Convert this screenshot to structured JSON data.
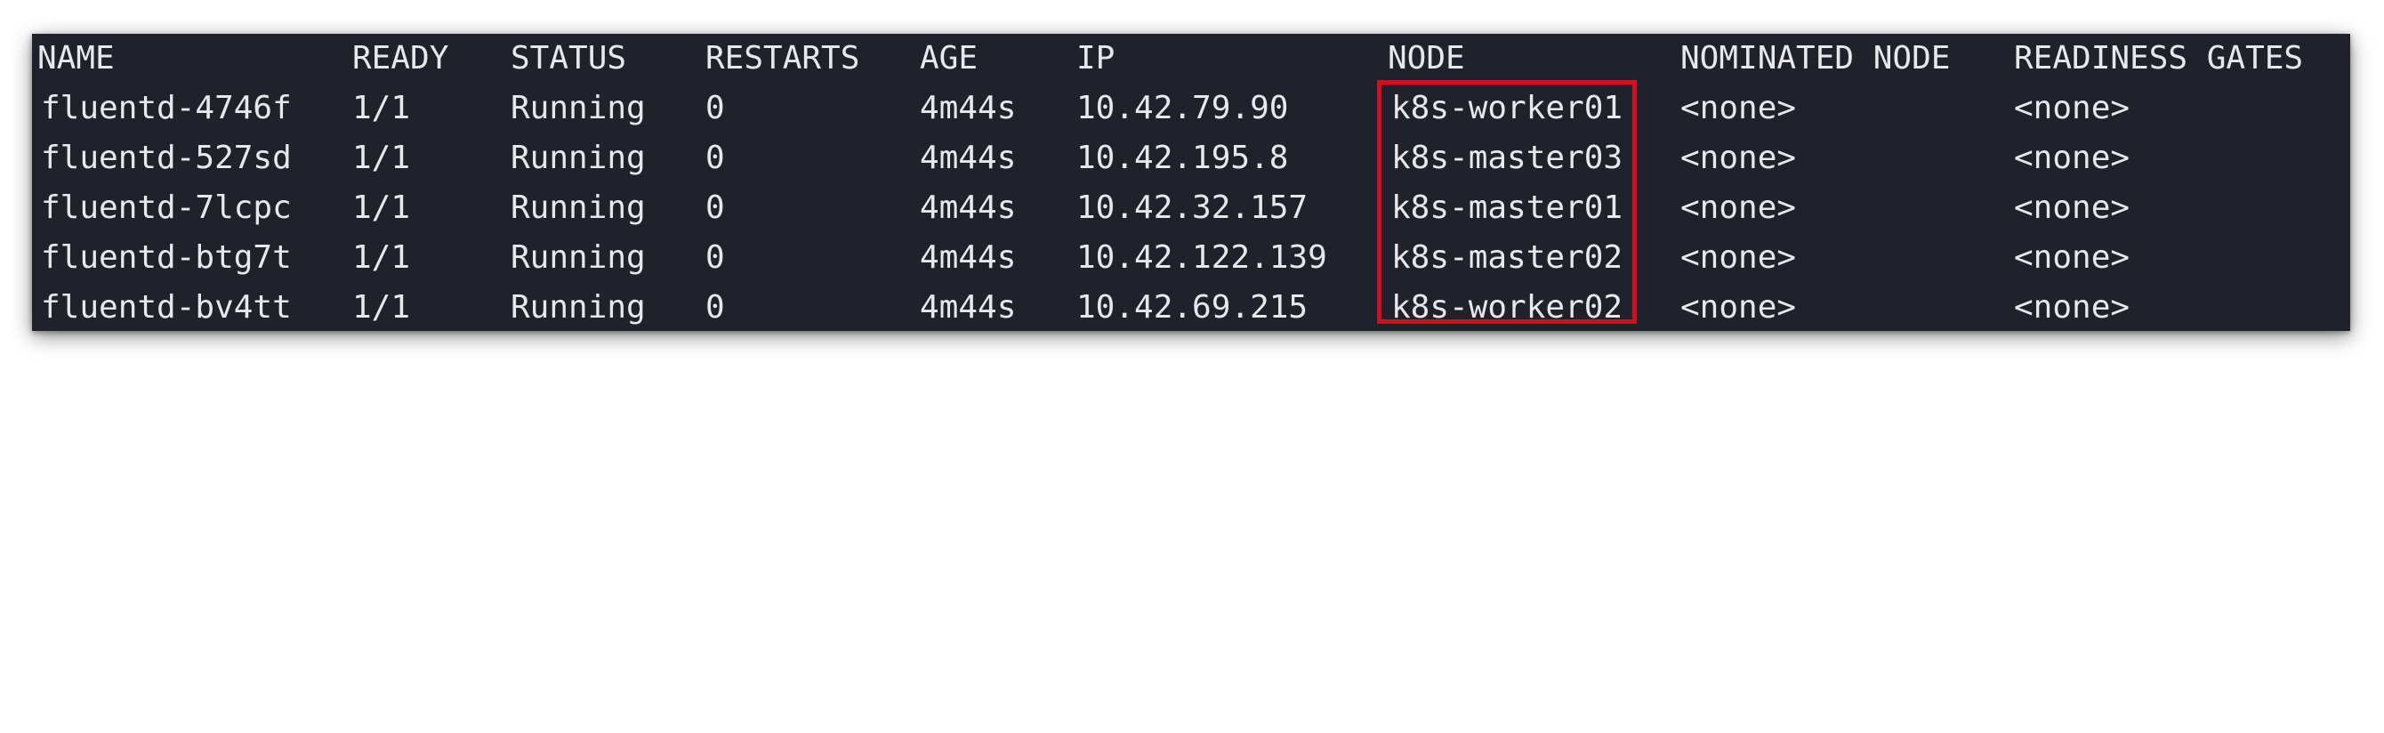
{
  "table": {
    "headers": {
      "name": "NAME",
      "ready": "READY",
      "status": "STATUS",
      "restarts": "RESTARTS",
      "age": "AGE",
      "ip": "IP",
      "node": "NODE",
      "nominated_node": "NOMINATED NODE",
      "readiness_gates": "READINESS GATES"
    },
    "rows": [
      {
        "name": "fluentd-4746f",
        "ready": "1/1",
        "status": "Running",
        "restarts": "0",
        "age": "4m44s",
        "ip": "10.42.79.90",
        "node": "k8s-worker01",
        "nominated_node": "<none>",
        "readiness_gates": "<none>"
      },
      {
        "name": "fluentd-527sd",
        "ready": "1/1",
        "status": "Running",
        "restarts": "0",
        "age": "4m44s",
        "ip": "10.42.195.8",
        "node": "k8s-master03",
        "nominated_node": "<none>",
        "readiness_gates": "<none>"
      },
      {
        "name": "fluentd-7lcpc",
        "ready": "1/1",
        "status": "Running",
        "restarts": "0",
        "age": "4m44s",
        "ip": "10.42.32.157",
        "node": "k8s-master01",
        "nominated_node": "<none>",
        "readiness_gates": "<none>"
      },
      {
        "name": "fluentd-btg7t",
        "ready": "1/1",
        "status": "Running",
        "restarts": "0",
        "age": "4m44s",
        "ip": "10.42.122.139",
        "node": "k8s-master02",
        "nominated_node": "<none>",
        "readiness_gates": "<none>"
      },
      {
        "name": "fluentd-bv4tt",
        "ready": "1/1",
        "status": "Running",
        "restarts": "0",
        "age": "4m44s",
        "ip": "10.42.69.215",
        "node": "k8s-worker02",
        "nominated_node": "<none>",
        "readiness_gates": "<none>"
      }
    ]
  },
  "colors": {
    "terminal_background": "#1f212b",
    "terminal_text": "#e8e8ea",
    "highlight_border": "#d0101e"
  }
}
